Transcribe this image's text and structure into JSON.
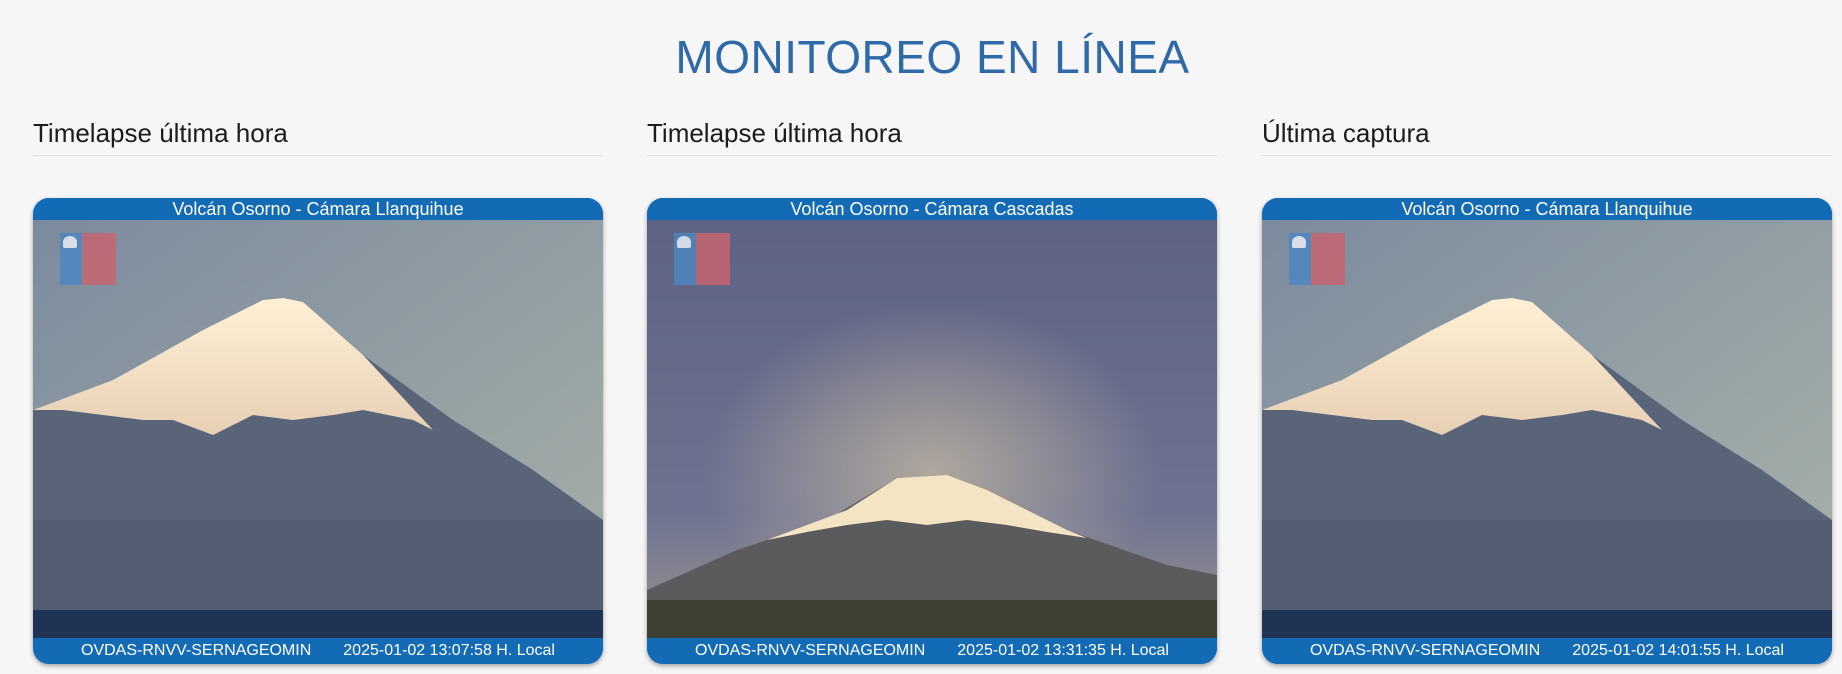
{
  "page": {
    "title": "MONITOREO EN LÍNEA"
  },
  "columns": [
    {
      "heading": "Timelapse última hora",
      "camera": {
        "title": "Volcán Osorno - Cámara Llanquihue",
        "source": "OVDAS-RNVV-SERNAGEOMIN",
        "timestamp": "2025-01-02 13:07:58 H. Local"
      }
    },
    {
      "heading": "Timelapse última hora",
      "camera": {
        "title": "Volcán Osorno - Cámara Cascadas",
        "source": "OVDAS-RNVV-SERNAGEOMIN",
        "timestamp": "2025-01-02 13:31:35 H. Local"
      }
    },
    {
      "heading": "Última captura",
      "camera": {
        "title": "Volcán Osorno - Cámara Llanquihue",
        "source": "OVDAS-RNVV-SERNAGEOMIN",
        "timestamp": "2025-01-02 14:01:55 H. Local"
      }
    }
  ],
  "colors": {
    "title": "#2f6aa8",
    "camera_bar": "#146bb5",
    "background": "#f6f6f6"
  }
}
